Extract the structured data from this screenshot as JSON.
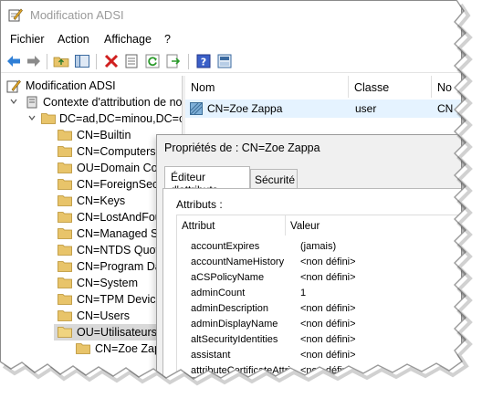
{
  "window": {
    "title": "Modification ADSI"
  },
  "menu": [
    "Fichier",
    "Action",
    "Affichage",
    "?"
  ],
  "toolbar": [
    "back-icon",
    "forward-icon",
    "up-folder-icon",
    "show-hide-tree-icon",
    "delete-icon",
    "properties-icon",
    "refresh-icon",
    "export-icon",
    "help-icon",
    "info-icon"
  ],
  "tree": {
    "root": "Modification ADSI",
    "context": "Contexte d'attribution de no",
    "domain": "DC=ad,DC=minou,DC=c",
    "containers": [
      "CN=Builtin",
      "CN=Computers",
      "OU=Domain Co",
      "CN=ForeignSecu",
      "CN=Keys",
      "CN=LostAndFou",
      "CN=Managed S",
      "CN=NTDS Quota",
      "CN=Program Da",
      "CN=System",
      "CN=TPM Device",
      "CN=Users",
      "OU=Utilisateurs"
    ],
    "selected_child": "CN=Zoe Zappa"
  },
  "list": {
    "headers": [
      "Nom",
      "Classe",
      "No"
    ],
    "rows": [
      {
        "name": "CN=Zoe Zappa",
        "class": "user",
        "dn": "CN"
      }
    ]
  },
  "dialog": {
    "title": "Propriétés de : CN=Zoe Zappa",
    "tabs": [
      "Éditeur d'attributs",
      "Sécurité"
    ],
    "attributes_label": "Attributs :",
    "grid_headers": [
      "Attribut",
      "Valeur"
    ],
    "rows": [
      {
        "attr": "accountExpires",
        "value": "(jamais)"
      },
      {
        "attr": "accountNameHistory",
        "value": "<non défini>"
      },
      {
        "attr": "aCSPolicyName",
        "value": "<non défini>"
      },
      {
        "attr": "adminCount",
        "value": "1"
      },
      {
        "attr": "adminDescription",
        "value": "<non défini>"
      },
      {
        "attr": "adminDisplayName",
        "value": "<non défini>"
      },
      {
        "attr": "altSecurityIdentities",
        "value": "<non défini>"
      },
      {
        "attr": "assistant",
        "value": "<non défini>"
      },
      {
        "attr": "attributeCertificateAttri",
        "value": "<non défini>"
      }
    ]
  },
  "colors": {
    "selection": "#d9d9d9",
    "list_selection": "#e5f3ff",
    "folder": "#e8c46a",
    "dialog_bg": "#f0f0f0"
  }
}
